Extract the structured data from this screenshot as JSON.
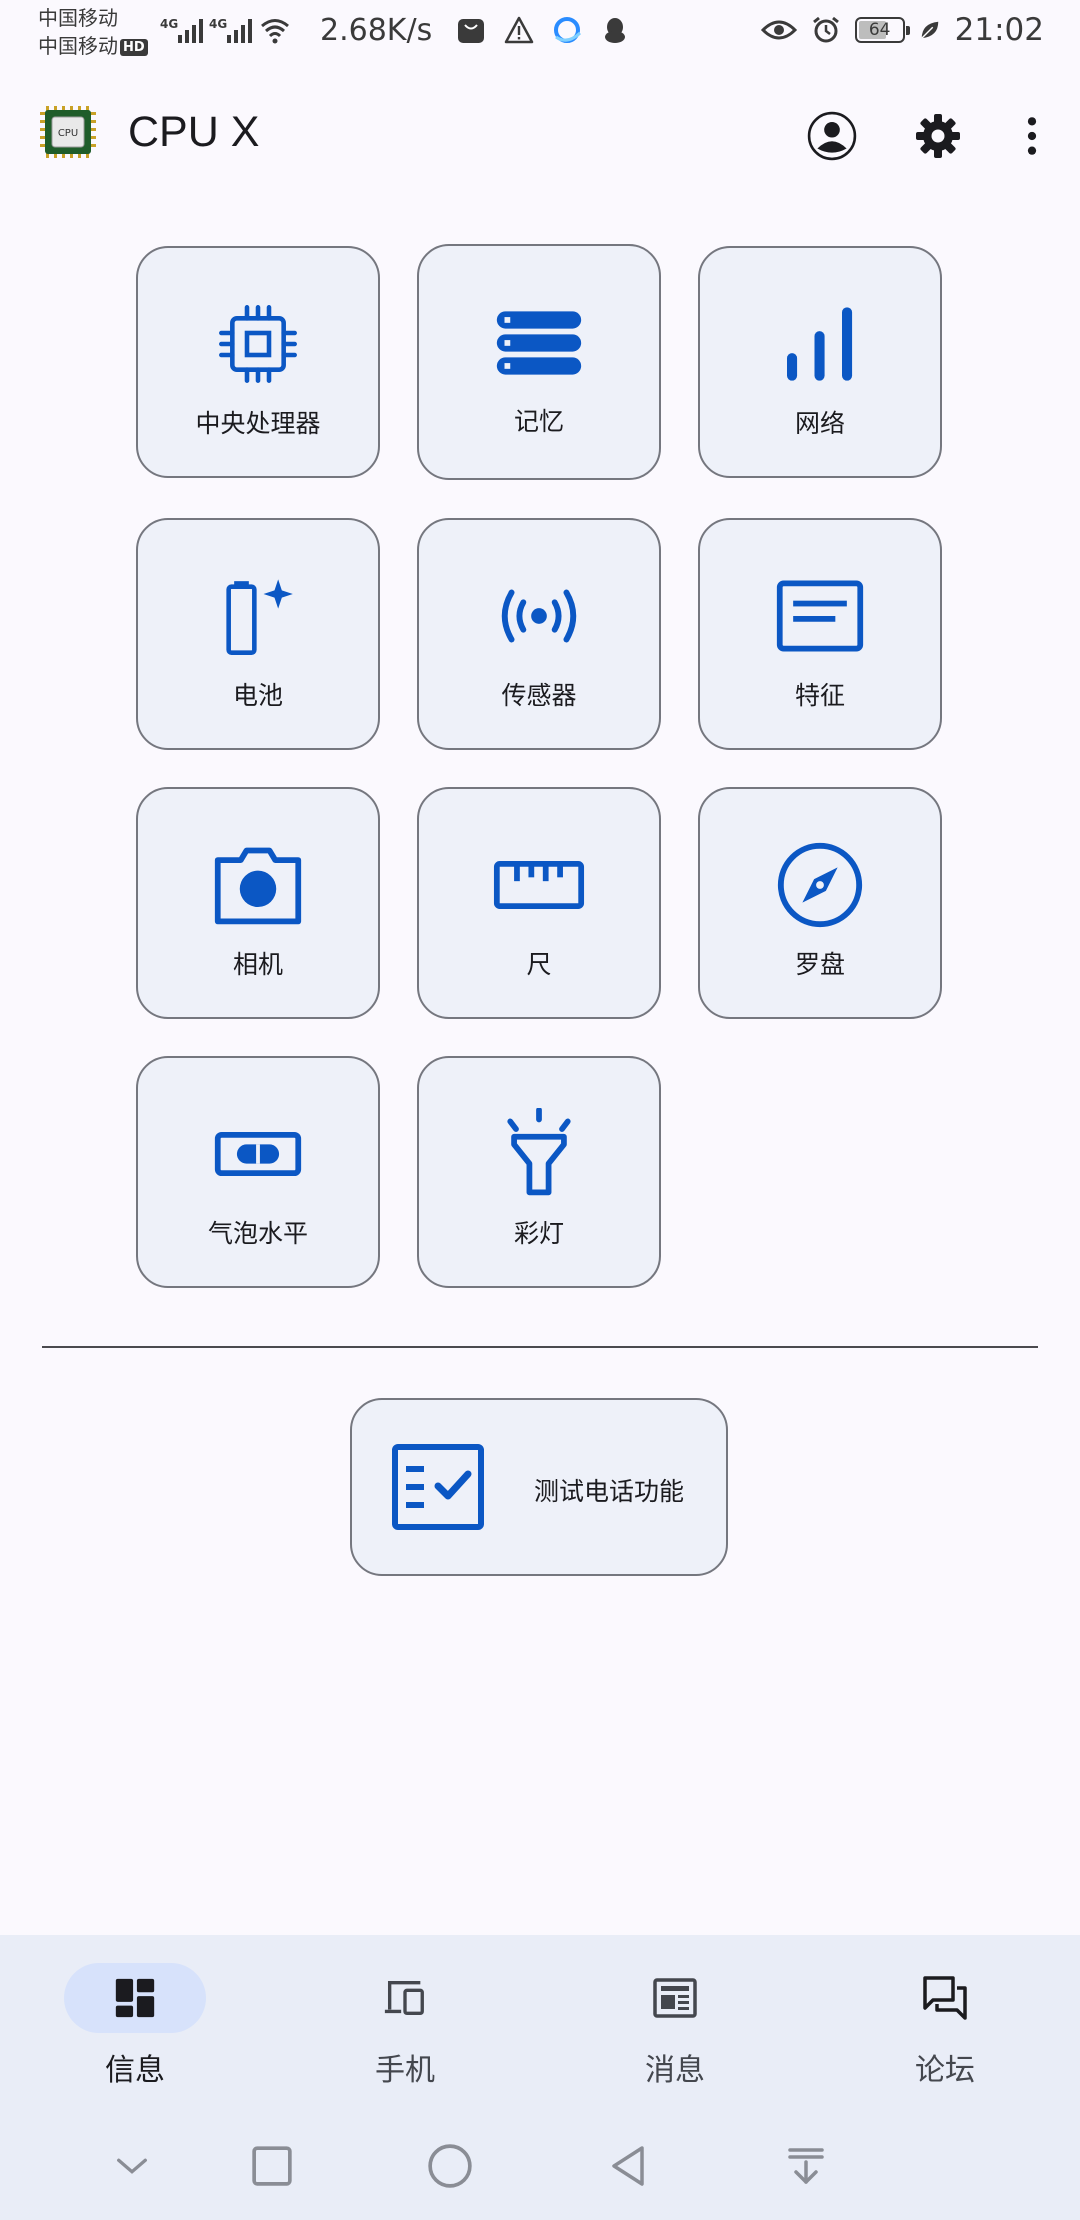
{
  "status_bar": {
    "carrier_1": "中国移动",
    "carrier_2": "中国移动",
    "hd_badge": "HD",
    "network_tag_1": "4G",
    "network_tag_2": "4G",
    "net_speed": "2.68K/s",
    "battery_level": "64",
    "time": "21:02",
    "icons": [
      "signal-icon",
      "wifi-icon",
      "huawei-store-icon",
      "warning-icon",
      "browser-icon",
      "qq-icon",
      "eye-icon",
      "alarm-icon",
      "battery-icon",
      "leaf-icon"
    ]
  },
  "app_bar": {
    "logo_text": "CPU",
    "title": "CPU X",
    "actions": [
      "account-icon",
      "settings-icon",
      "more-vert-icon"
    ]
  },
  "tiles": [
    {
      "label": "中央处理器",
      "icon": "cpu-icon"
    },
    {
      "label": "记忆",
      "icon": "memory-icon"
    },
    {
      "label": "网络",
      "icon": "network-signal-icon"
    },
    {
      "label": "电池",
      "icon": "battery-icon"
    },
    {
      "label": "传感器",
      "icon": "sensors-icon"
    },
    {
      "label": "特征",
      "icon": "features-icon"
    },
    {
      "label": "相机",
      "icon": "camera-icon"
    },
    {
      "label": "尺",
      "icon": "ruler-icon"
    },
    {
      "label": "罗盘",
      "icon": "compass-icon"
    },
    {
      "label": "气泡水平",
      "icon": "bubble-level-icon"
    },
    {
      "label": "彩灯",
      "icon": "flashlight-icon"
    }
  ],
  "test_phone": {
    "label": "测试电话功能",
    "icon": "checklist-icon"
  },
  "bottom_nav": [
    {
      "label": "信息",
      "icon": "dashboard-icon",
      "active": true
    },
    {
      "label": "手机",
      "icon": "devices-icon",
      "active": false
    },
    {
      "label": "消息",
      "icon": "news-icon",
      "active": false
    },
    {
      "label": "论坛",
      "icon": "forum-icon",
      "active": false
    }
  ],
  "system_nav": [
    "hide-chevron-icon",
    "recents-icon",
    "home-icon",
    "back-icon",
    "notification-pull-icon"
  ],
  "colors": {
    "accent": "#0b57c4",
    "tile_bg": "#eef1f9",
    "tile_border": "#75777f",
    "nav_bg": "#e9edf7",
    "nav_active": "#d7e2fb"
  }
}
